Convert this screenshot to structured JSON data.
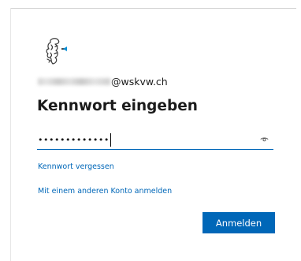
{
  "identity": {
    "email_domain": "@wskvw.ch"
  },
  "title": "Kennwort eingeben",
  "password": {
    "masked_value": "•••••••••••••"
  },
  "links": {
    "forgot": "Kennwort vergessen",
    "other_account": "Mit einem anderen Konto anmelden"
  },
  "buttons": {
    "signin": "Anmelden"
  },
  "colors": {
    "accent": "#0067b8",
    "text": "#1b1b1b",
    "background": "#ffffff"
  },
  "icons": {
    "logo": "bear-crest-logo",
    "reveal": "eye-icon"
  }
}
